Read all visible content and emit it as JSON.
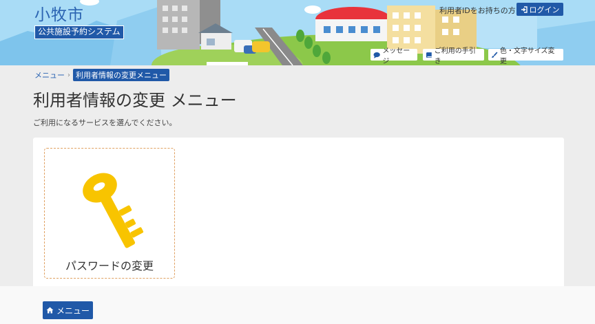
{
  "header": {
    "site_name": "小牧市",
    "system_name": "公共施設予約システム",
    "login_hint": "利用者IDをお持ちの方",
    "login_label": "ログイン",
    "links": [
      {
        "label": "メッセージ",
        "icon": "comment-icon"
      },
      {
        "label": "ご利用の手引き",
        "icon": "book-icon"
      },
      {
        "label": "色・文字サイズ変更",
        "icon": "brush-icon"
      }
    ]
  },
  "breadcrumb": {
    "home": "メニュー",
    "separator": "›",
    "current": "利用者情報の変更メニュー"
  },
  "page": {
    "title": "利用者情報の変更 メニュー",
    "description": "ご利用になるサービスを選んでください。"
  },
  "cards": [
    {
      "label": "パスワードの変更",
      "icon": "key-icon",
      "icon_color": "#f8c400"
    }
  ],
  "footer": {
    "menu_label": "メニュー"
  },
  "colors": {
    "brand": "#2059a8",
    "sky": "#a9dcf6",
    "card_border": "#e0a060"
  }
}
